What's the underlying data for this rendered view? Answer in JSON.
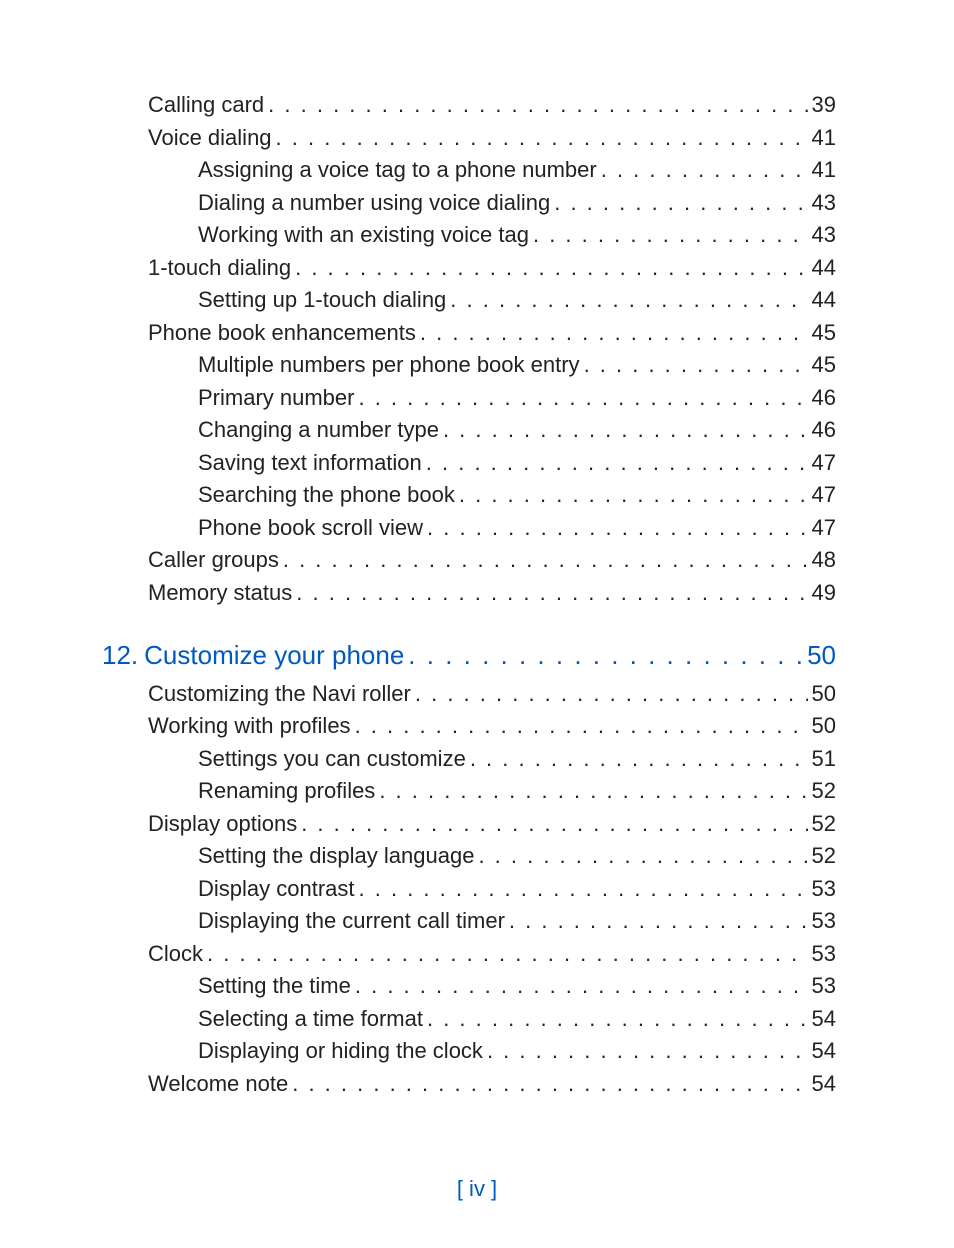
{
  "toc": [
    {
      "level": 1,
      "label": "Calling card",
      "page": "39"
    },
    {
      "level": 1,
      "label": "Voice dialing",
      "page": "41"
    },
    {
      "level": 2,
      "label": "Assigning a voice tag to a phone number",
      "page": "41"
    },
    {
      "level": 2,
      "label": "Dialing a number using voice dialing",
      "page": "43"
    },
    {
      "level": 2,
      "label": "Working with an existing voice tag",
      "page": "43"
    },
    {
      "level": 1,
      "label": "1-touch dialing",
      "page": "44"
    },
    {
      "level": 2,
      "label": "Setting up 1-touch dialing",
      "page": "44"
    },
    {
      "level": 1,
      "label": "Phone book enhancements",
      "page": "45"
    },
    {
      "level": 2,
      "label": "Multiple numbers per phone book entry",
      "page": "45"
    },
    {
      "level": 2,
      "label": "Primary number",
      "page": "46"
    },
    {
      "level": 2,
      "label": "Changing a number type",
      "page": "46"
    },
    {
      "level": 2,
      "label": "Saving text information",
      "page": "47"
    },
    {
      "level": 2,
      "label": "Searching the phone book",
      "page": "47"
    },
    {
      "level": 2,
      "label": "Phone book scroll view",
      "page": "47"
    },
    {
      "level": 1,
      "label": "Caller groups",
      "page": "48"
    },
    {
      "level": 1,
      "label": "Memory status",
      "page": "49"
    },
    {
      "level": "chapter",
      "num": "12.",
      "label": "Customize your phone",
      "page": "50"
    },
    {
      "level": 1,
      "label": "Customizing the Navi roller",
      "page": "50"
    },
    {
      "level": 1,
      "label": "Working with profiles",
      "page": "50"
    },
    {
      "level": 2,
      "label": "Settings you can customize",
      "page": "51"
    },
    {
      "level": 2,
      "label": "Renaming profiles",
      "page": "52"
    },
    {
      "level": 1,
      "label": "Display options",
      "page": "52"
    },
    {
      "level": 2,
      "label": "Setting the display language",
      "page": "52"
    },
    {
      "level": 2,
      "label": "Display contrast",
      "page": "53"
    },
    {
      "level": 2,
      "label": "Displaying the current call timer",
      "page": "53"
    },
    {
      "level": 1,
      "label": "Clock",
      "page": "53"
    },
    {
      "level": 2,
      "label": "Setting the time",
      "page": "53"
    },
    {
      "level": 2,
      "label": "Selecting a time format",
      "page": "54"
    },
    {
      "level": 2,
      "label": "Displaying or hiding the clock",
      "page": "54"
    },
    {
      "level": 1,
      "label": "Welcome note",
      "page": "54"
    }
  ],
  "footer": "[ iv ]"
}
